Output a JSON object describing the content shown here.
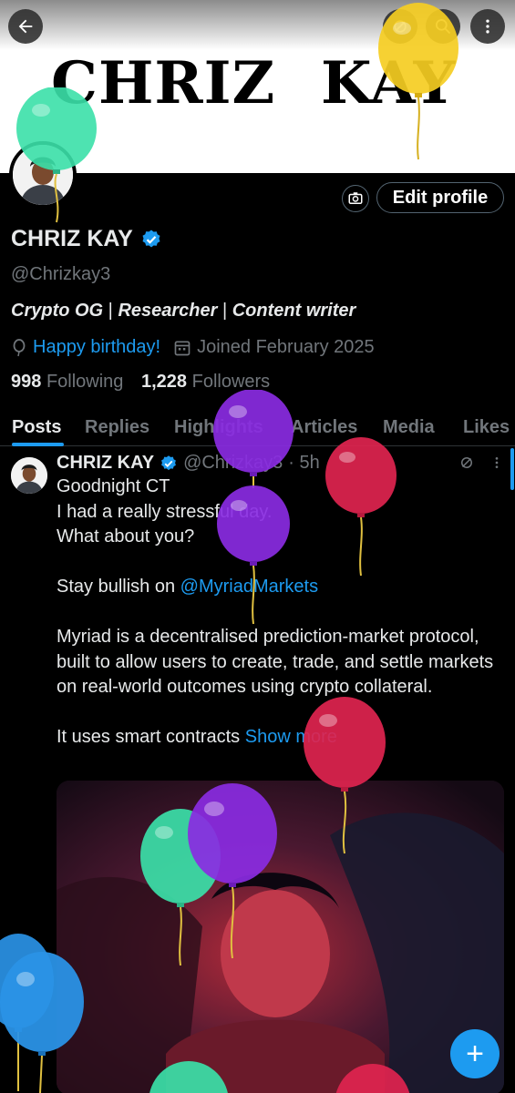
{
  "banner": {
    "left_text": "CHRIZ",
    "right_text": "KAY"
  },
  "header_icons": {
    "back": "arrow-left-icon",
    "grok": "grok-icon",
    "search": "search-icon",
    "more": "more-vertical-icon"
  },
  "profile": {
    "edit_label": "Edit profile",
    "name": "CHRIZ KAY",
    "handle": "@Chrizkay3",
    "bio": {
      "part1": "Crypto OG",
      "sep1": " | ",
      "part2": "Researcher",
      "sep2": " | ",
      "part3": "Content writer"
    },
    "birthday": "Happy birthday!",
    "joined": "Joined February 2025",
    "following_count": "998",
    "following_label": "Following",
    "followers_count": "1,228",
    "followers_label": "Followers"
  },
  "tabs": [
    "Posts",
    "Replies",
    "Highlights",
    "Articles",
    "Media",
    "Likes"
  ],
  "post": {
    "author": "CHRIZ KAY",
    "handle": "@Chrizkay3",
    "time": "· 5h",
    "line1": "Goodnight CT",
    "line2": "I had a really stressful day.",
    "line3": "What about you?",
    "line4_prefix": "Stay bullish on ",
    "mention": "@MyriadMarkets",
    "paragraph": "Myriad is a decentralised prediction-market protocol, built to allow users to create, trade, and settle markets on real-world outcomes using crypto collateral.",
    "line5": "It uses smart contracts ",
    "show_more": "Show more"
  },
  "fab_label": "+",
  "colors": {
    "accent": "#1d9bf0",
    "muted": "#71767b",
    "balloon_green": "#3be0a8",
    "balloon_yellow": "#f5cd22",
    "balloon_purple": "#8a2be2",
    "balloon_red": "#e0244f",
    "balloon_blue": "#2a92e6"
  }
}
